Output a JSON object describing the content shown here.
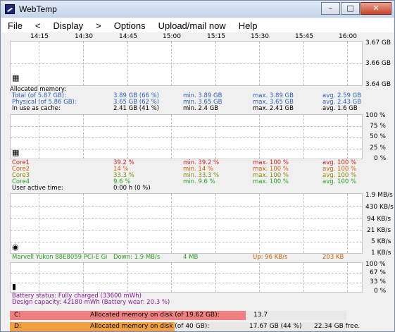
{
  "window": {
    "title": "WebTemp",
    "min_label": "–",
    "max_label": "□",
    "close_label": "✕"
  },
  "menu": {
    "file": "File",
    "back": "<",
    "display": "Display",
    "forward": ">",
    "options": "Options",
    "upload": "Upload/mail now",
    "help": "Help"
  },
  "time_axis": [
    "14:15",
    "14:30",
    "14:45",
    "15:00",
    "15:15",
    "15:30",
    "15:45",
    "16:00"
  ],
  "memory": {
    "axis": [
      "3.67 GB",
      "3.66 GB",
      "3.64 GB"
    ],
    "heading": "Allocated memory:",
    "rows": [
      {
        "label": "Total (of 5.87 GB):",
        "value": "3.89 GB (66 %)",
        "min": "min. 3.89 GB",
        "max": "max. 3.89 GB",
        "avg": "avg. 2.59 GB"
      },
      {
        "label": "Physical (of 5.86 GB):",
        "value": "3.65 GB (62 %)",
        "min": "min. 3.65 GB",
        "max": "max. 3.65 GB",
        "avg": "avg. 2.43 GB"
      },
      {
        "label": "In use as cache:",
        "value": "2.41 GB (41 %)",
        "min": "min. 2.4 GB",
        "max": "max. 2.41 GB",
        "avg": "avg. 1.6 GB"
      }
    ]
  },
  "cpu": {
    "axis": [
      "100 %",
      "75 %",
      "50 %",
      "25 %",
      "0 %"
    ],
    "rows": [
      {
        "label": "Core1",
        "value": "39.2 %",
        "min": "min. 39.2 %",
        "max": "max. 100 %",
        "avg": "avg. 100 %"
      },
      {
        "label": "Core2",
        "value": "14 %",
        "min": "min. 14 %",
        "max": "max. 100 %",
        "avg": "avg. 100 %"
      },
      {
        "label": "Core3",
        "value": "33.3 %",
        "min": "min. 33.3 %",
        "max": "max. 100 %",
        "avg": "avg. 100 %"
      },
      {
        "label": "Core4",
        "value": "9.6 %",
        "min": "min. 9.6 %",
        "max": "max. 100 %",
        "avg": "avg. 100 %"
      }
    ],
    "active_label": "User active time:",
    "active_value": "0:00 h (0 %)"
  },
  "network": {
    "axis": [
      "1.9 MB/s",
      "430 KB/s",
      "94 KB/s",
      "21 KB/s",
      "5 KB/s",
      "1 KB/s"
    ],
    "adapter": "Marvell Yukon 88E8059 PCI-E Gi",
    "down": "Down: 1.9 MB/s",
    "down_total": "4 MB",
    "up": "Up: 96 KB/s",
    "up_total": "203 KB"
  },
  "battery": {
    "axis": [
      "100 %",
      "67 %",
      "33 %",
      "0 %"
    ],
    "status": "Battery status: Fully charged (33600 mWh)",
    "capacity": "Design capacity: 42180 mWh (Battery wear: 20.3 %)"
  },
  "disks": [
    {
      "letter": "C:",
      "label": "Allocated memory on disk (of 19.62 GB):",
      "value": "13.7",
      "free": "",
      "fill_pct": 70,
      "color": "#f08080"
    },
    {
      "letter": "D:",
      "label": "Allocated memory on disk (of 40 GB):",
      "value": "17.67 GB (44 %)",
      "free": "22.34 GB free.",
      "fill_pct": 49,
      "color": "#f0a040"
    }
  ],
  "colors": {
    "memory": "#2a5fbf",
    "core1": "#d42020",
    "core2": "#d06000",
    "core3": "#8a8a00",
    "core4": "#2aa020",
    "network": "#2aa020",
    "upload": "#d06000",
    "battery": "#8a18a0"
  }
}
